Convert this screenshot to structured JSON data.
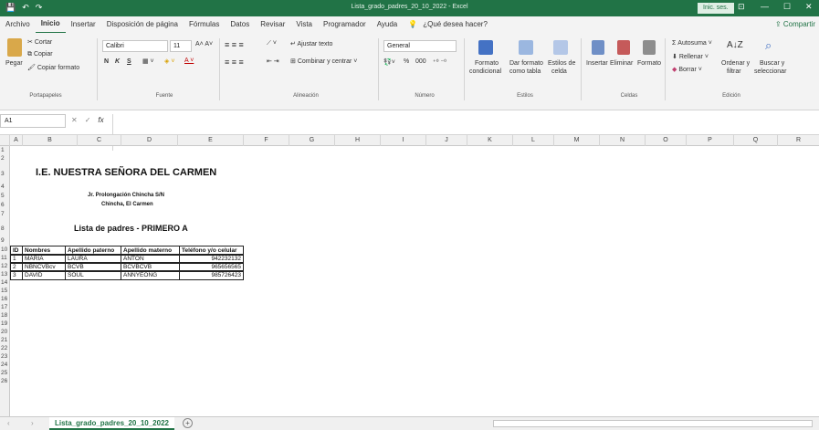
{
  "window": {
    "title": "Lista_grado_padres_20_10_2022  -  Excel",
    "sign_in": "Inic. ses.",
    "qa_save": "💾",
    "qa_undo": "↶",
    "qa_redo": "↷",
    "btn_restore": "⊡",
    "btn_min": "—",
    "btn_max": "☐",
    "btn_close": "✕"
  },
  "menu": {
    "items": [
      "Archivo",
      "Inicio",
      "Insertar",
      "Disposición de página",
      "Fórmulas",
      "Datos",
      "Revisar",
      "Vista",
      "Programador",
      "Ayuda"
    ],
    "tell_me": "¿Qué desea hacer?",
    "share": "Compartir"
  },
  "ribbon": {
    "clipboard": {
      "paste": "Pegar",
      "cut": "Cortar",
      "copy": "Copiar",
      "format_painter": "Copiar formato",
      "group": "Portapapeles"
    },
    "font": {
      "name": "Calibri",
      "size": "11",
      "bold": "N",
      "italic": "K",
      "underline": "S",
      "group": "Fuente"
    },
    "alignment": {
      "wrap": "Ajustar texto",
      "merge": "Combinar y centrar",
      "group": "Alineación"
    },
    "number": {
      "format": "General",
      "percent": "%",
      "thousands": "000",
      "group": "Número"
    },
    "styles": {
      "cond": "Formato",
      "cond2": "condicional",
      "table": "Dar formato",
      "table2": "como tabla",
      "cell": "Estilos de",
      "cell2": "celda",
      "group": "Estilos"
    },
    "cells": {
      "insert": "Insertar",
      "delete": "Eliminar",
      "format": "Formato",
      "group": "Celdas"
    },
    "editing": {
      "autosum": "Autosuma",
      "fill": "Rellenar",
      "clear": "Borrar",
      "sort": "Ordenar y",
      "sort2": "filtrar",
      "find": "Buscar y",
      "find2": "seleccionar",
      "group": "Edición"
    }
  },
  "formula_bar": {
    "name_box": "A1",
    "fx": "fx",
    "value": ""
  },
  "columns": [
    "A",
    "B",
    "C",
    "D",
    "E",
    "F",
    "G",
    "H",
    "I",
    "J",
    "K",
    "L",
    "M",
    "N",
    "O",
    "P",
    "Q",
    "R"
  ],
  "rows": [
    "1",
    "2",
    "3",
    "4",
    "5",
    "6",
    "7",
    "8",
    "9",
    "10",
    "11",
    "12",
    "13",
    "14",
    "15",
    "16",
    "17",
    "18",
    "19",
    "20",
    "21",
    "22",
    "23",
    "24",
    "25",
    "26"
  ],
  "sheet": {
    "title": "I.E. NUESTRA SEÑORA DEL CARMEN",
    "address1": "Jr. Prolongación Chincha S/N",
    "address2": "Chincha, El Carmen",
    "list_title": "Lista de padres - PRIMERO A",
    "headers": [
      "ID",
      "Nombres",
      "Apellido paterno",
      "Apellido materno",
      "Teléfono y/o celular"
    ],
    "rows": [
      [
        "1",
        "MARIA",
        "LAURA",
        "ANTON",
        "942232132"
      ],
      [
        "2",
        "NBNCVBcv",
        "BCVB",
        "BCVBCVB",
        "965656565"
      ],
      [
        "3",
        "DAVID",
        "SOUL",
        "ANNYEONG",
        "985726423"
      ]
    ]
  },
  "tabs": {
    "active": "Lista_grado_padres_20_10_2022",
    "add": "+"
  }
}
